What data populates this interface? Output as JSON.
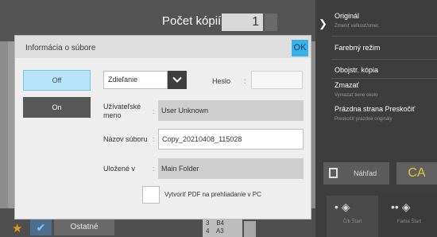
{
  "header": {
    "copies_label": "Počet kópií",
    "copies_value": "1"
  },
  "right_panel": {
    "items": [
      {
        "label": "Originál",
        "sub": "Zmeniť veľkosť/smer."
      },
      {
        "label": "Farebný režim",
        "sub": ""
      },
      {
        "label": "Obojstr. kópia",
        "sub": ""
      },
      {
        "label": "Zmazať",
        "sub": "Vymazať tiene okolo"
      },
      {
        "label": "Prázdna strana Preskočiť",
        "sub": "Preskočiť prázdne originály"
      }
    ],
    "preview_label": "Náhľad",
    "ca_label": "CA",
    "bw_start_label": "Č/b Štart",
    "color_start_label": "Farba Štart"
  },
  "bottom_bar": {
    "more_label": "Ostatné",
    "trays": [
      {
        "num": "3",
        "size": "B4"
      },
      {
        "num": "4",
        "size": "A3"
      }
    ]
  },
  "dialog": {
    "title": "Informácia o súbore",
    "ok_label": "OK",
    "off_label": "Off",
    "on_label": "On",
    "share_value": "Zdieľanie",
    "password_label": "Heslo",
    "password_value": "",
    "colon": ":",
    "user_label": "Užívateľské meno",
    "user_value": "User Unknown",
    "filename_label": "Názov súboru",
    "filename_value": "Copy_20210408_115028",
    "saved_in_label": "Uložené v",
    "saved_in_value": "Main Folder",
    "pdf_label": "Vytvoriť PDF na prehliadanie v PC"
  }
}
